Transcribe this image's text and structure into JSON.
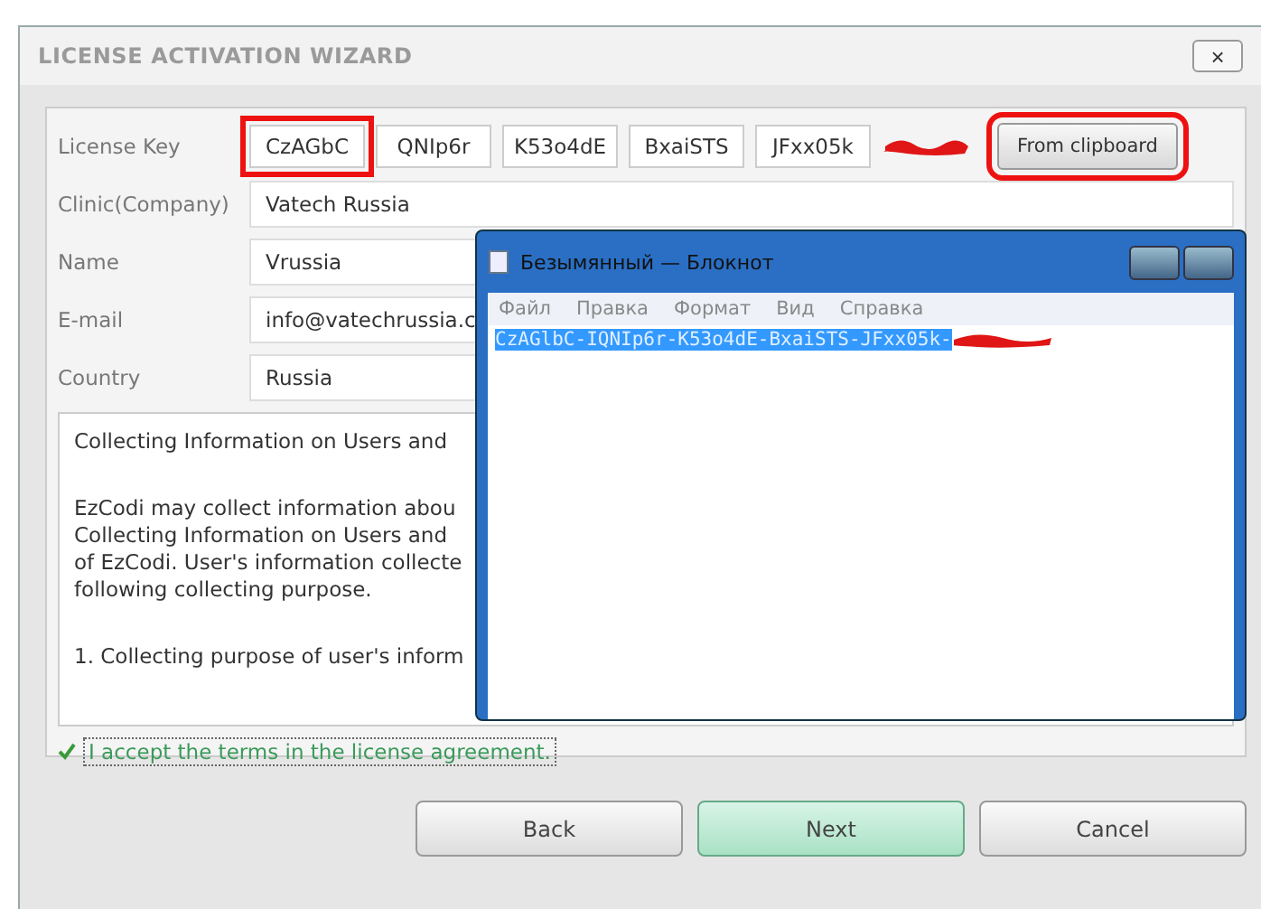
{
  "wizard": {
    "title": "LICENSE ACTIVATION WIZARD",
    "close": "×",
    "license_key": {
      "label": "License Key",
      "parts": [
        "CzAGbC",
        "QNIp6r",
        "K53o4dE",
        "BxaiSTS",
        "JFxx05k"
      ],
      "paste_button": "From clipboard"
    },
    "fields": [
      {
        "label": "Clinic(Company)",
        "value": "Vatech Russia"
      },
      {
        "label": "Name",
        "value": "Vrussia"
      },
      {
        "label": "E-mail",
        "value": "info@vatechrussia.c"
      },
      {
        "label": "Country",
        "value": "Russia"
      }
    ],
    "agreement": [
      "Collecting Information on Users and",
      "EzCodi may collect information abou\nCollecting Information on Users and\nof EzCodi. User's information collecte\nfollowing collecting purpose.",
      "1. Collecting purpose of user's inform"
    ],
    "accept": {
      "label": "I accept the terms in the license agreement.",
      "checked": true
    },
    "buttons": [
      {
        "label": "Back",
        "selected": false
      },
      {
        "label": "Next",
        "selected": true
      },
      {
        "label": "Cancel",
        "selected": false
      }
    ]
  },
  "notepad": {
    "title": "Безымянный — Блокнот",
    "menu": [
      "Файл",
      "Правка",
      "Формат",
      "Вид",
      "Справка"
    ],
    "text": "CzAGlbC-IQNIp6r-K53o4dE-BxaiSTS-JFxx05k-"
  }
}
